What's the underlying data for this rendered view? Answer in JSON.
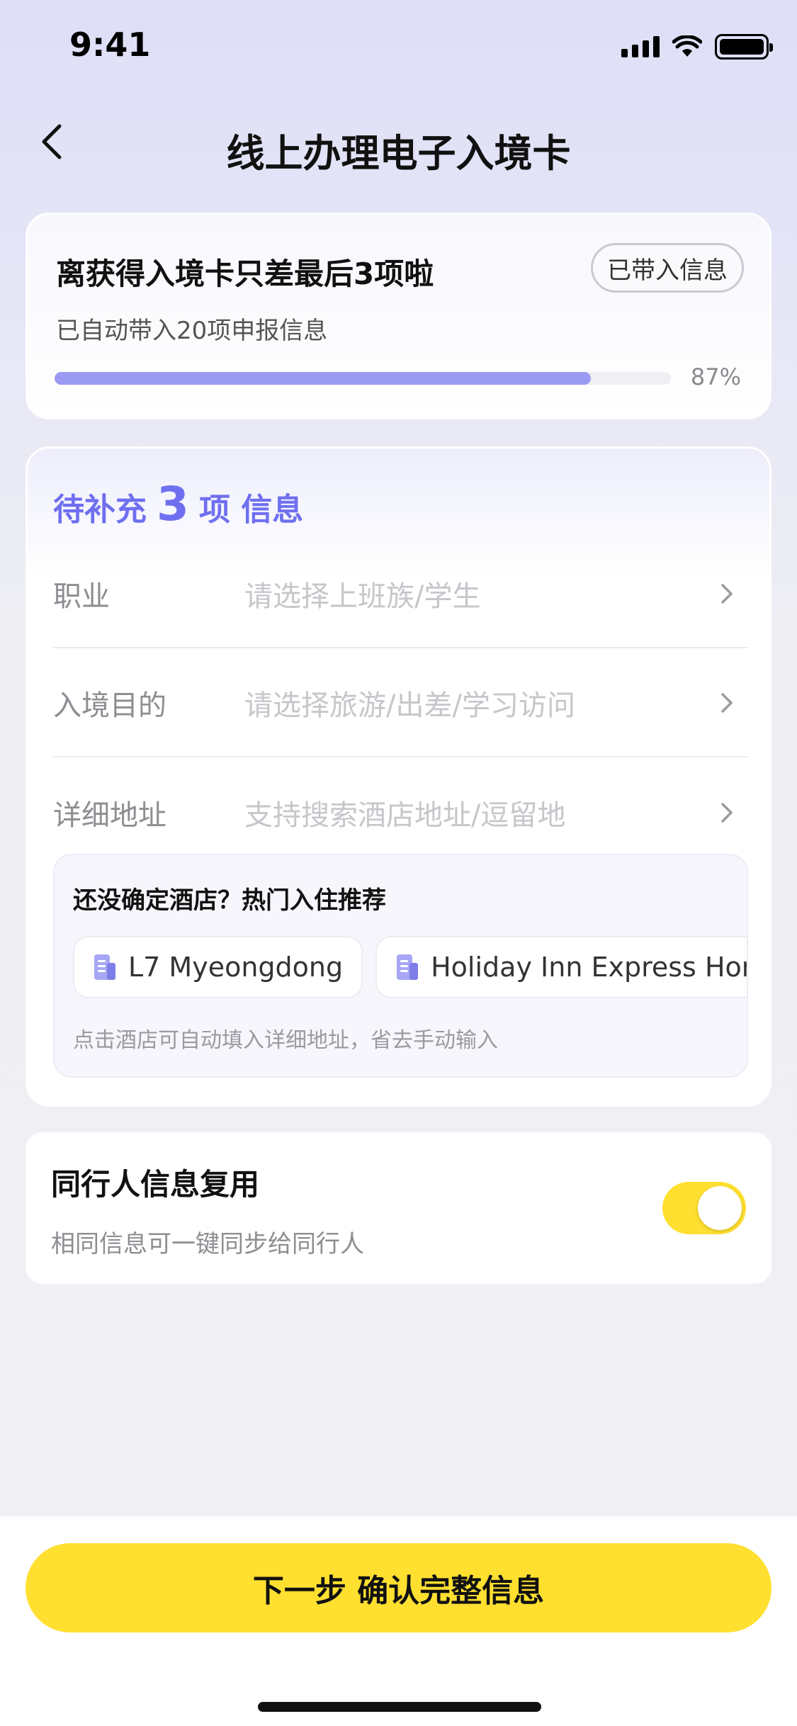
{
  "status_bar": {
    "time": "9:41"
  },
  "nav": {
    "title": "线上办理电子入境卡"
  },
  "progress_card": {
    "headline": "离获得入境卡只差最后3项啦",
    "chip_label": "已带入信息",
    "subtitle": "已自动带入20项申报信息",
    "progress_percent": 87,
    "progress_label": "87%",
    "progress_color": "#9a9af2"
  },
  "form_card": {
    "heading_prefix": "待补充",
    "heading_count": "3",
    "heading_suffix": "项 信息",
    "heading_color": "#6f6ff0",
    "rows": [
      {
        "label": "职业",
        "placeholder": "请选择上班族/学生"
      },
      {
        "label": "入境目的",
        "placeholder": "请选择旅游/出差/学习访问"
      },
      {
        "label": "详细地址",
        "placeholder": "支持搜索酒店地址/逗留地"
      }
    ],
    "hotels": {
      "title": "还没确定酒店？热门入住推荐",
      "items": [
        {
          "name": "L7 Myeongdong",
          "icon": "document-icon"
        },
        {
          "name": "Holiday Inn Express Hong",
          "icon": "document-icon"
        }
      ],
      "hint": "点击酒店可自动填入详细地址，省去手动输入"
    }
  },
  "companion_card": {
    "title": "同行人信息复用",
    "subtitle": "相同信息可一键同步给同行人",
    "toggle_on": true,
    "toggle_color": "#ffe030"
  },
  "bottom": {
    "next_label": "下一步 确认完整信息",
    "button_color": "#ffe030"
  }
}
